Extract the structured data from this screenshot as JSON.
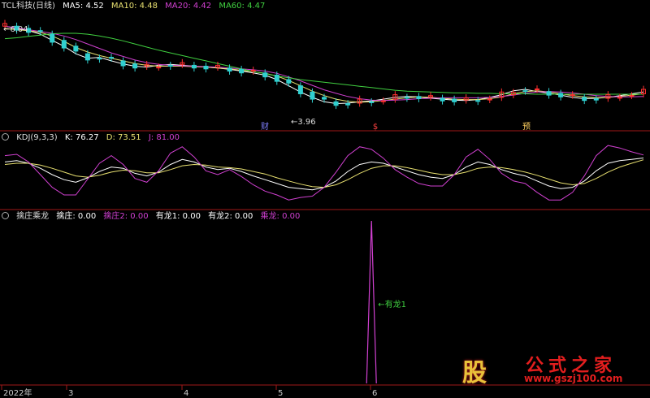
{
  "price_panel": {
    "title": "TCL科技(日线)",
    "ma_labels": [
      {
        "text": "MA5: 4.52",
        "color": "#ffffff"
      },
      {
        "text": "MA10: 4.48",
        "color": "#e8e070"
      },
      {
        "text": "MA20: 4.42",
        "color": "#d040d0"
      },
      {
        "text": "MA60: 4.47",
        "color": "#40d040"
      }
    ],
    "high_label": "6.04",
    "low_label": "3.96",
    "markers": [
      {
        "text": "财",
        "color": "#8080ff"
      },
      {
        "text": "$",
        "color": "#ff4040"
      },
      {
        "text": "预",
        "color": "#ffd060"
      }
    ]
  },
  "kdj_panel": {
    "title": "KDJ(9,3,3)",
    "k_label": "K: 76.27",
    "d_label": "D: 73.51",
    "j_label": "J: 81.00",
    "j_color": "#d040d0"
  },
  "dragon_panel": {
    "title": "擒庄乘龙",
    "labels": [
      {
        "text": "擒庄: 0.00",
        "color": "#ffffff"
      },
      {
        "text": "擒庄2: 0.00",
        "color": "#d040d0"
      },
      {
        "text": "有龙1: 0.00",
        "color": "#ffffff"
      },
      {
        "text": "有龙2: 0.00",
        "color": "#ffffff"
      },
      {
        "text": "乘龙: 0.00",
        "color": "#d040d0"
      }
    ],
    "spike_annotation": "有龙1"
  },
  "x_axis": {
    "labels": [
      "2022年",
      "3",
      "4",
      "5",
      "6"
    ]
  },
  "watermark": {
    "glyph": "股",
    "title": "公式之家",
    "url": "www.gszj100.com"
  },
  "chart_data": [
    {
      "type": "line",
      "title": "TCL科技(日线)",
      "series": [
        {
          "name": "MA5",
          "color": "#ffffff",
          "values": [
            6.0,
            5.95,
            5.9,
            5.82,
            5.68,
            5.55,
            5.38,
            5.28,
            5.3,
            5.22,
            5.15,
            5.1,
            5.08,
            5.12,
            5.14,
            5.12,
            5.1,
            5.08,
            5.06,
            5.03,
            4.99,
            4.95,
            4.9,
            4.8,
            4.66,
            4.52,
            4.4,
            4.3,
            4.26,
            4.27,
            4.3,
            4.32,
            4.36,
            4.4,
            4.42,
            4.41,
            4.38,
            4.36,
            4.34,
            4.33,
            4.35,
            4.4,
            4.46,
            4.55,
            4.58,
            4.53,
            4.49,
            4.45,
            4.4,
            4.37,
            4.38,
            4.4,
            4.44,
            4.48,
            4.52
          ]
        },
        {
          "name": "MA10",
          "color": "#e8e070",
          "values": [
            5.95,
            5.92,
            5.9,
            5.86,
            5.78,
            5.66,
            5.52,
            5.42,
            5.34,
            5.28,
            5.22,
            5.16,
            5.12,
            5.1,
            5.1,
            5.1,
            5.09,
            5.08,
            5.06,
            5.04,
            5.01,
            4.98,
            4.94,
            4.88,
            4.78,
            4.66,
            4.54,
            4.44,
            4.36,
            4.31,
            4.29,
            4.3,
            4.33,
            4.36,
            4.39,
            4.41,
            4.4,
            4.38,
            4.36,
            4.35,
            4.35,
            4.37,
            4.41,
            4.48,
            4.53,
            4.55,
            4.52,
            4.48,
            4.44,
            4.41,
            4.39,
            4.4,
            4.42,
            4.45,
            4.48
          ]
        },
        {
          "name": "MA20",
          "color": "#d040d0",
          "values": [
            6.0,
            5.96,
            5.92,
            5.88,
            5.84,
            5.78,
            5.7,
            5.6,
            5.5,
            5.4,
            5.32,
            5.24,
            5.18,
            5.14,
            5.12,
            5.11,
            5.1,
            5.09,
            5.08,
            5.06,
            5.04,
            5.02,
            4.99,
            4.94,
            4.86,
            4.77,
            4.67,
            4.57,
            4.49,
            4.42,
            4.37,
            4.34,
            4.33,
            4.34,
            4.35,
            4.37,
            4.38,
            4.39,
            4.39,
            4.39,
            4.39,
            4.4,
            4.42,
            4.45,
            4.49,
            4.52,
            4.53,
            4.52,
            4.5,
            4.47,
            4.44,
            4.42,
            4.41,
            4.41,
            4.42
          ]
        },
        {
          "name": "MA60",
          "color": "#40d040",
          "values": [
            5.72,
            5.74,
            5.77,
            5.8,
            5.83,
            5.84,
            5.84,
            5.82,
            5.78,
            5.73,
            5.67,
            5.6,
            5.53,
            5.46,
            5.4,
            5.34,
            5.28,
            5.22,
            5.16,
            5.1,
            5.04,
            4.98,
            4.93,
            4.88,
            4.84,
            4.8,
            4.77,
            4.74,
            4.71,
            4.68,
            4.65,
            4.62,
            4.59,
            4.56,
            4.54,
            4.53,
            4.52,
            4.51,
            4.5,
            4.5,
            4.49,
            4.49,
            4.48,
            4.48,
            4.48,
            4.47,
            4.47,
            4.47,
            4.47,
            4.47,
            4.47,
            4.47,
            4.47,
            4.47,
            4.47
          ]
        }
      ],
      "ylim": [
        3.85,
        6.15
      ]
    },
    {
      "type": "line",
      "title": "KDJ(9,3,3)",
      "series": [
        {
          "name": "K",
          "color": "#ffffff",
          "values": [
            70,
            72,
            68,
            60,
            50,
            42,
            38,
            45,
            55,
            62,
            60,
            52,
            48,
            54,
            66,
            74,
            70,
            62,
            58,
            60,
            55,
            48,
            42,
            36,
            30,
            28,
            26,
            30,
            40,
            55,
            66,
            70,
            68,
            62,
            56,
            50,
            46,
            44,
            50,
            62,
            70,
            66,
            58,
            52,
            48,
            40,
            32,
            28,
            30,
            40,
            56,
            68,
            72,
            74,
            76.27
          ]
        },
        {
          "name": "D",
          "color": "#e8e070",
          "values": [
            66,
            68,
            68,
            65,
            60,
            54,
            48,
            46,
            49,
            54,
            57,
            56,
            53,
            53,
            58,
            64,
            66,
            65,
            62,
            61,
            59,
            55,
            51,
            45,
            40,
            35,
            31,
            30,
            34,
            42,
            52,
            60,
            64,
            64,
            61,
            57,
            53,
            50,
            50,
            54,
            60,
            62,
            61,
            58,
            54,
            49,
            43,
            37,
            34,
            36,
            44,
            54,
            62,
            68,
            73.51
          ]
        },
        {
          "name": "J",
          "color": "#d040d0",
          "values": [
            80,
            82,
            70,
            50,
            30,
            18,
            18,
            43,
            68,
            80,
            66,
            44,
            38,
            56,
            84,
            94,
            78,
            56,
            50,
            58,
            47,
            34,
            24,
            18,
            10,
            14,
            16,
            30,
            54,
            80,
            94,
            90,
            76,
            58,
            46,
            36,
            32,
            32,
            50,
            78,
            90,
            74,
            52,
            40,
            36,
            22,
            10,
            10,
            22,
            48,
            80,
            96,
            92,
            86,
            81.0
          ]
        }
      ],
      "ylim": [
        0,
        100
      ]
    },
    {
      "type": "line",
      "title": "擒庄乘龙",
      "series": [
        {
          "name": "有龙1",
          "color": "#d040d0",
          "values": [
            0,
            0,
            0,
            0,
            0,
            0,
            0,
            0,
            0,
            0,
            0,
            0,
            0,
            0,
            0,
            0,
            0,
            0,
            0,
            0,
            0,
            0,
            0,
            0,
            0,
            0,
            0,
            0,
            0,
            0,
            0,
            1,
            0,
            0,
            0,
            0,
            0,
            0,
            0,
            0,
            0,
            0,
            0,
            0,
            0,
            0,
            0,
            0,
            0,
            0,
            0,
            0,
            0,
            0,
            0
          ]
        }
      ],
      "ylim": [
        0,
        1
      ]
    }
  ]
}
